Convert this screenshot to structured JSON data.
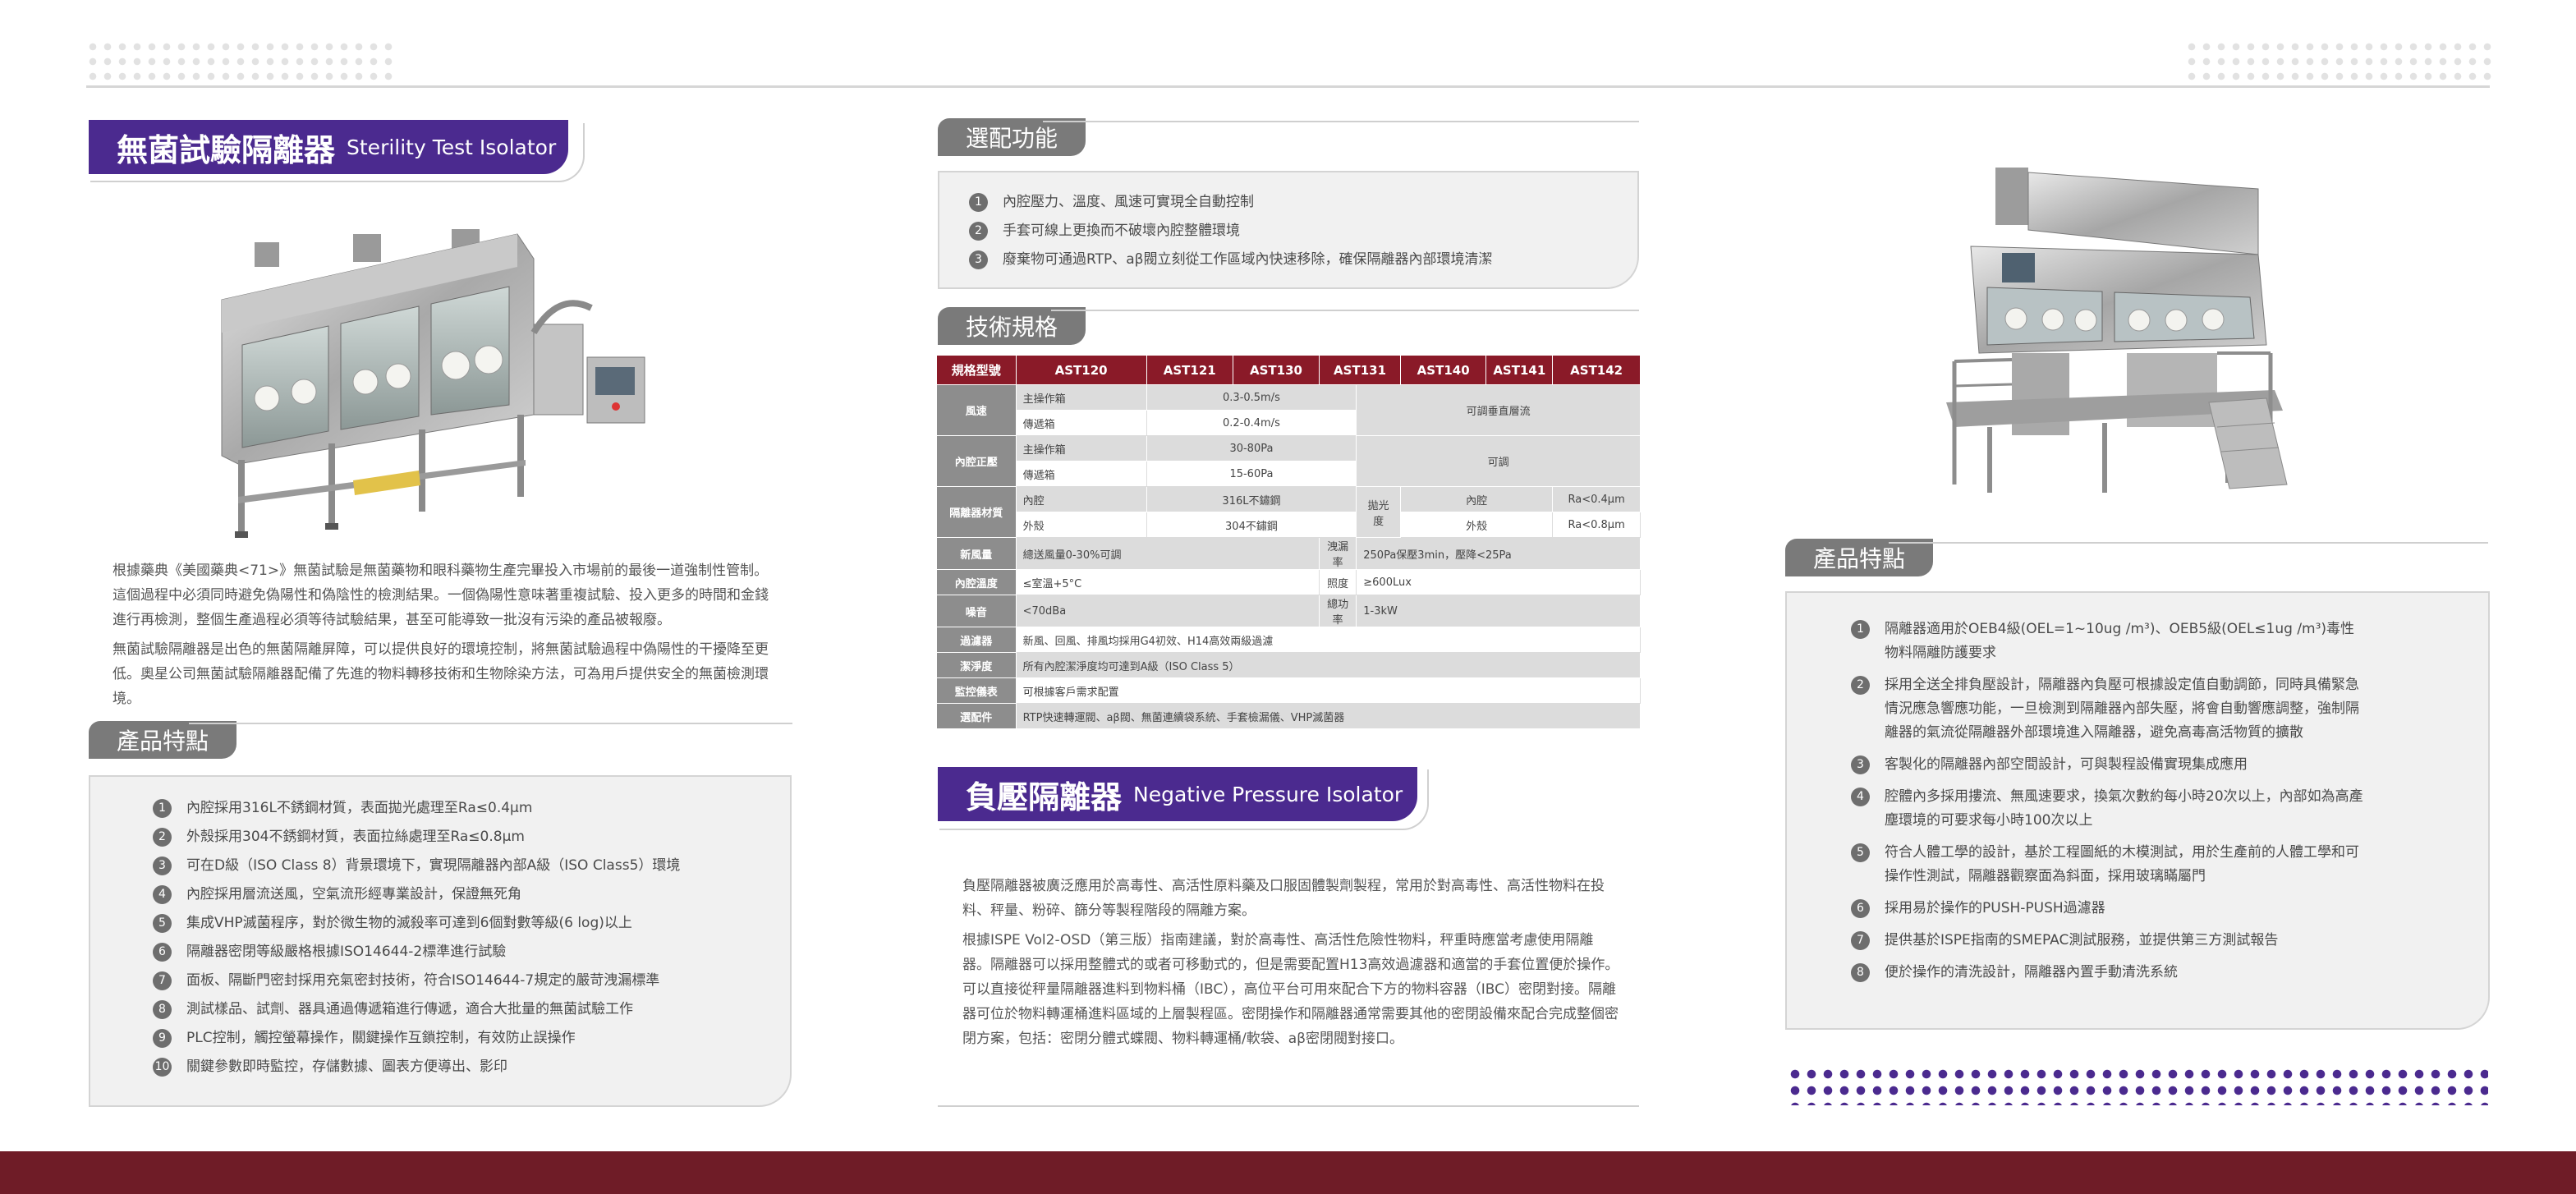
{
  "sterility": {
    "title_zh": "無菌試驗隔離器",
    "title_en": "Sterility Test Isolator",
    "paragraphs": [
      "根據藥典《美國藥典<71>》無菌試驗是無菌藥物和眼科藥物生產完畢投入市場前的最後一道強制性管制。這個過程中必須同時避免偽陽性和偽陰性的檢測結果。一個偽陽性意味著重複試驗、投入更多的時間和金錢進行再檢測，整個生產過程必須等待試驗結果，甚至可能導致一批沒有污染的產品被報廢。",
      "無菌試驗隔離器是出色的無菌隔離屏障，可以提供良好的環境控制，將無菌試驗過程中偽陽性的干擾降至更低。奧星公司無菌試驗隔離器配備了先進的物料轉移技術和生物除染方法，可為用戶提供安全的無菌檢測環境。"
    ],
    "features_label": "產品特點",
    "features": [
      "內腔採用316L不銹鋼材質，表面拋光處理至Ra≤0.4μm",
      "外殼採用304不銹鋼材質，表面拉絲處理至Ra≤0.8μm",
      "可在D級（ISO Class 8）背景環境下，實現隔離器內部A級（ISO Class5）環境",
      "內腔採用層流送風，空氣流形經專業設計，保證無死角",
      "集成VHP滅菌程序，對於微生物的滅殺率可達到6個對數等級(6 log)以上",
      "隔離器密閉等級嚴格根據ISO14644-2標準進行試驗",
      "面板、隔斷門密封採用充氣密封技術，符合ISO14644-7規定的嚴苛洩漏標準",
      "測試樣品、試劑、器具通過傳遞箱進行傳遞，適合大批量的無菌試驗工作",
      "PLC控制，觸控螢幕操作，關鍵操作互鎖控制，有效防止誤操作",
      "關鍵參數即時監控，存儲數據、圖表方便導出、影印"
    ]
  },
  "options": {
    "label": "選配功能",
    "items": [
      "內腔壓力、溫度、風速可實現全自動控制",
      "手套可線上更換而不破壞內腔整體環境",
      "廢棄物可通過RTP、aβ閥立刻從工作區域內快速移除，確保隔離器內部環境清潔"
    ]
  },
  "spec": {
    "label": "技術規格",
    "header": [
      "規格型號",
      "AST120",
      "AST121",
      "AST130",
      "AST131",
      "AST140",
      "AST141",
      "AST142"
    ],
    "wind": {
      "label": "風速",
      "r1": "主操作箱",
      "r2": "傳遞箱",
      "v1": "0.3-0.5m/s",
      "v2": "0.2-0.4m/s",
      "right": "可調垂直層流"
    },
    "pressure": {
      "label": "內腔正壓",
      "r1": "主操作箱",
      "r2": "傳遞箱",
      "v1": "30-80Pa",
      "v2": "15-60Pa",
      "right": "可調"
    },
    "material": {
      "label": "隔離器材質",
      "r1": "內腔",
      "r2": "外殼",
      "v1": "316L不鏽鋼",
      "v2": "304不鏽鋼",
      "gloss": "拋光度",
      "g1": "內腔",
      "g2": "外殼",
      "gv1": "Ra<0.4μm",
      "gv2": "Ra<0.8μm"
    },
    "fresh": {
      "label": "新風量",
      "v": "總送風量0-30%可調",
      "k2": "洩漏率",
      "v2": "250Pa保壓3min，壓降<25Pa"
    },
    "temp": {
      "label": "內腔溫度",
      "v": "≤室溫+5°C",
      "k2": "照度",
      "v2": "≥600Lux"
    },
    "noise": {
      "label": "噪音",
      "v": "<70dBa",
      "k2": "總功率",
      "v2": "1-3kW"
    },
    "filter": {
      "label": "過濾器",
      "v": "新風、回風、排風均採用G4初效、H14高效兩級過濾"
    },
    "clean": {
      "label": "潔淨度",
      "v": "所有內腔潔淨度均可達到A級（ISO Class 5）"
    },
    "monitor": {
      "label": "監控儀表",
      "v": "可根據客戶需求配置"
    },
    "accessory": {
      "label": "選配件",
      "v": "RTP快速轉運閥、aβ閥、無菌連續袋系統、手套檢漏儀、VHP滅菌器"
    }
  },
  "negative": {
    "title_zh": "負壓隔離器",
    "title_en": "Negative Pressure Isolator",
    "paragraphs": [
      "負壓隔離器被廣泛應用於高毒性、高活性原料藥及口服固體製劑製程，常用於對高毒性、高活性物料在投料、秤量、粉碎、篩分等製程階段的隔離方案。",
      "根據ISPE Vol2-OSD（第三版）指南建議，對於高毒性、高活性危險性物料，秤重時應當考慮使用隔離器。隔離器可以採用整體式的或者可移動式的，但是需要配置H13高效過濾器和適當的手套位置便於操作。可以直接從秤量隔離器進料到物料桶（IBC），高位平台可用來配合下方的物料容器（IBC）密閉對接。隔離器可位於物料轉運桶進料區域的上層製程區。密閉操作和隔離器通常需要其他的密閉設備來配合完成整個密閉方案，包括：密閉分體式蝶閥、物料轉運桶/軟袋、aβ密閉閥對接口。"
    ],
    "features_label": "產品特點",
    "features": [
      "隔離器適用於OEB4級(OEL=1~10ug /m³)、OEB5級(OEL≤1ug /m³)毒性物料隔離防護要求",
      "採用全送全排負壓設計，隔離器內負壓可根據設定值自動調節，同時具備緊急情況應急響應功能，一旦檢測到隔離器內部失壓，將會自動響應調整，強制隔離器的氣流從隔離器外部環境進入隔離器，避免高毒高活物質的擴散",
      "客製化的隔離器內部空間設計，可與製程設備實現集成應用",
      "腔體內多採用摟流、無風速要求，換氣次數約每小時20次以上，內部如為高產塵環境的可要求每小時100次以上",
      "符合人體工學的設計，基於工程圖紙的木模測試，用於生產前的人體工學和可操作性測試，隔離器觀察面為斜面，採用玻璃瞞屬門",
      "採用易於操作的PUSH-PUSH過濾器",
      "提供基於ISPE指南的SMEPAC測試服務，並提供第三方測試報告",
      "便於操作的清洗設計，隔離器內置手動清洗系統"
    ]
  },
  "colors": {
    "brand_purple": "#4b2a8f",
    "brand_red": "#8a1a28",
    "footer": "#6f1c27",
    "tag_gray": "#7a7a7a"
  }
}
